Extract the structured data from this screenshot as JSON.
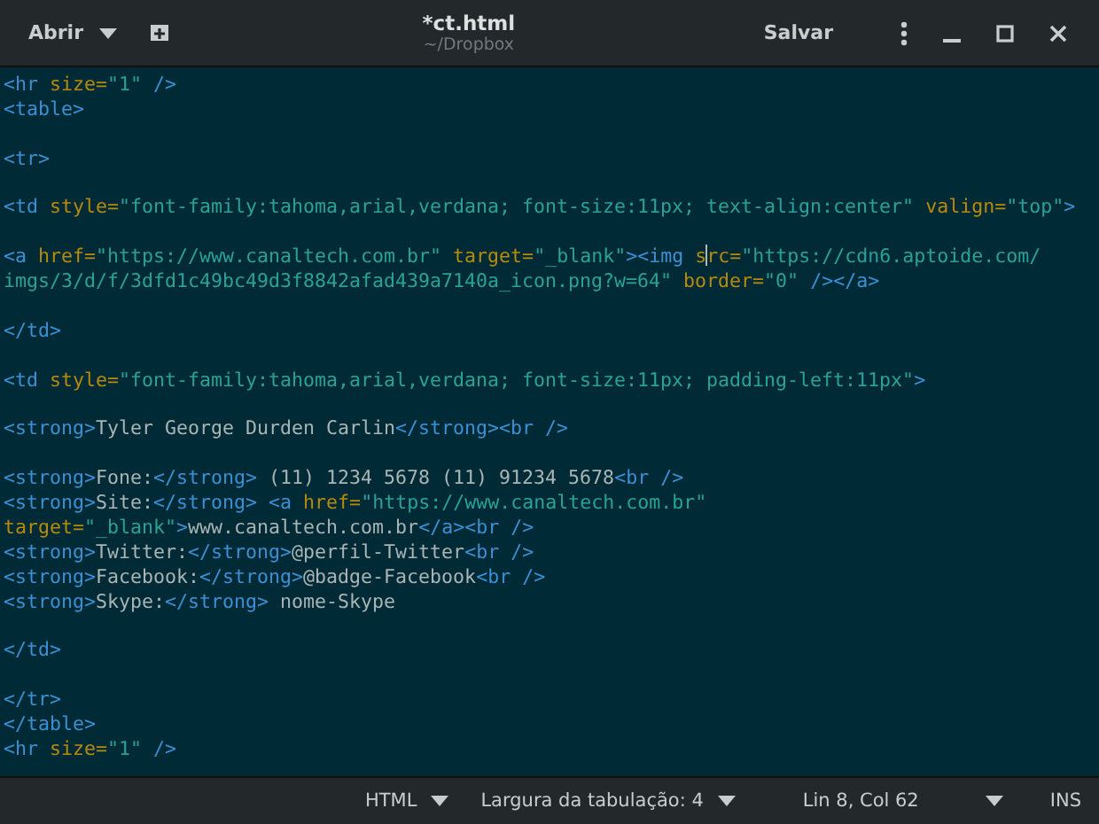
{
  "header": {
    "open_button": "Abrir",
    "title": "*ct.html",
    "subtitle": "~/Dropbox",
    "save_button": "Salvar"
  },
  "editor": {
    "lines": [
      {
        "kind": "code",
        "tokens": [
          {
            "kind": "tag",
            "text": "<hr"
          },
          {
            "kind": "attr",
            "text": " size="
          },
          {
            "kind": "str",
            "text": "\"1\""
          },
          {
            "kind": "tag",
            "text": " />"
          }
        ]
      },
      {
        "kind": "code",
        "tokens": [
          {
            "kind": "tag",
            "text": "<table>"
          }
        ]
      },
      {
        "kind": "blank"
      },
      {
        "kind": "code",
        "tokens": [
          {
            "kind": "tag",
            "text": "<tr>"
          }
        ]
      },
      {
        "kind": "blank"
      },
      {
        "kind": "code",
        "tokens": [
          {
            "kind": "tag",
            "text": "<td"
          },
          {
            "kind": "attr",
            "text": " style="
          },
          {
            "kind": "str",
            "text": "\"font-family:tahoma,arial,verdana; font-size:11px; text-align:center\""
          },
          {
            "kind": "attr",
            "text": " valign="
          },
          {
            "kind": "str",
            "text": "\"top\""
          },
          {
            "kind": "tag",
            "text": ">"
          }
        ]
      },
      {
        "kind": "blank"
      },
      {
        "kind": "code",
        "tokens": [
          {
            "kind": "tag",
            "text": "<a"
          },
          {
            "kind": "attr",
            "text": " href="
          },
          {
            "kind": "str",
            "text": "\"https://www.canaltech.com.br\""
          },
          {
            "kind": "attr",
            "text": " target="
          },
          {
            "kind": "str",
            "text": "\"_blank\""
          },
          {
            "kind": "tag",
            "text": "><img "
          },
          {
            "kind": "attr",
            "text": "s"
          },
          {
            "kind": "cursor"
          },
          {
            "kind": "attr",
            "text": "rc="
          },
          {
            "kind": "str",
            "text": "\"https://cdn6.aptoide.com/"
          }
        ]
      },
      {
        "kind": "code",
        "tokens": [
          {
            "kind": "str",
            "text": "imgs/3/d/f/3dfd1c49bc49d3f8842afad439a7140a_icon.png?w=64\""
          },
          {
            "kind": "attr",
            "text": " border="
          },
          {
            "kind": "str",
            "text": "\"0\""
          },
          {
            "kind": "tag",
            "text": " /></a>"
          }
        ]
      },
      {
        "kind": "blank"
      },
      {
        "kind": "code",
        "tokens": [
          {
            "kind": "tag",
            "text": "</td>"
          }
        ]
      },
      {
        "kind": "blank"
      },
      {
        "kind": "code",
        "tokens": [
          {
            "kind": "tag",
            "text": "<td"
          },
          {
            "kind": "attr",
            "text": " style="
          },
          {
            "kind": "str",
            "text": "\"font-family:tahoma,arial,verdana; font-size:11px; padding-left:11px\""
          },
          {
            "kind": "tag",
            "text": ">"
          }
        ]
      },
      {
        "kind": "blank"
      },
      {
        "kind": "code",
        "tokens": [
          {
            "kind": "tag",
            "text": "<strong>"
          },
          {
            "kind": "text",
            "text": "Tyler George Durden Carlin"
          },
          {
            "kind": "tag",
            "text": "</strong><br />"
          }
        ]
      },
      {
        "kind": "blank"
      },
      {
        "kind": "code",
        "tokens": [
          {
            "kind": "tag",
            "text": "<strong>"
          },
          {
            "kind": "text",
            "text": "Fone:"
          },
          {
            "kind": "tag",
            "text": "</strong>"
          },
          {
            "kind": "text",
            "text": " (11) 1234 5678 (11) 91234 5678"
          },
          {
            "kind": "tag",
            "text": "<br />"
          }
        ]
      },
      {
        "kind": "code",
        "tokens": [
          {
            "kind": "tag",
            "text": "<strong>"
          },
          {
            "kind": "text",
            "text": "Site:"
          },
          {
            "kind": "tag",
            "text": "</strong> <a"
          },
          {
            "kind": "attr",
            "text": " href="
          },
          {
            "kind": "str",
            "text": "\"https://www.canaltech.com.br\""
          }
        ]
      },
      {
        "kind": "code",
        "tokens": [
          {
            "kind": "attr",
            "text": "target="
          },
          {
            "kind": "str",
            "text": "\"_blank\""
          },
          {
            "kind": "tag",
            "text": ">"
          },
          {
            "kind": "text",
            "text": "www.canaltech.com.br"
          },
          {
            "kind": "tag",
            "text": "</a><br />"
          }
        ]
      },
      {
        "kind": "code",
        "tokens": [
          {
            "kind": "tag",
            "text": "<strong>"
          },
          {
            "kind": "text",
            "text": "Twitter:"
          },
          {
            "kind": "tag",
            "text": "</strong>"
          },
          {
            "kind": "text",
            "text": "@perfil-Twitter"
          },
          {
            "kind": "tag",
            "text": "<br />"
          }
        ]
      },
      {
        "kind": "code",
        "tokens": [
          {
            "kind": "tag",
            "text": "<strong>"
          },
          {
            "kind": "text",
            "text": "Facebook:"
          },
          {
            "kind": "tag",
            "text": "</strong>"
          },
          {
            "kind": "text",
            "text": "@badge-Facebook"
          },
          {
            "kind": "tag",
            "text": "<br />"
          }
        ]
      },
      {
        "kind": "code",
        "tokens": [
          {
            "kind": "tag",
            "text": "<strong>"
          },
          {
            "kind": "text",
            "text": "Skype:"
          },
          {
            "kind": "tag",
            "text": "</strong>"
          },
          {
            "kind": "text",
            "text": " nome-Skype"
          }
        ]
      },
      {
        "kind": "blank"
      },
      {
        "kind": "code",
        "tokens": [
          {
            "kind": "tag",
            "text": "</td>"
          }
        ]
      },
      {
        "kind": "blank"
      },
      {
        "kind": "code",
        "tokens": [
          {
            "kind": "tag",
            "text": "</tr>"
          }
        ]
      },
      {
        "kind": "code",
        "tokens": [
          {
            "kind": "tag",
            "text": "</table>"
          }
        ]
      },
      {
        "kind": "code",
        "tokens": [
          {
            "kind": "tag",
            "text": "<hr"
          },
          {
            "kind": "attr",
            "text": " size="
          },
          {
            "kind": "str",
            "text": "\"1\""
          },
          {
            "kind": "tag",
            "text": " />"
          }
        ]
      }
    ]
  },
  "status_bar": {
    "language": "HTML",
    "tab_width": "Largura da tabulação: 4",
    "position": "Lin 8, Col 62",
    "mode": "INS"
  }
}
